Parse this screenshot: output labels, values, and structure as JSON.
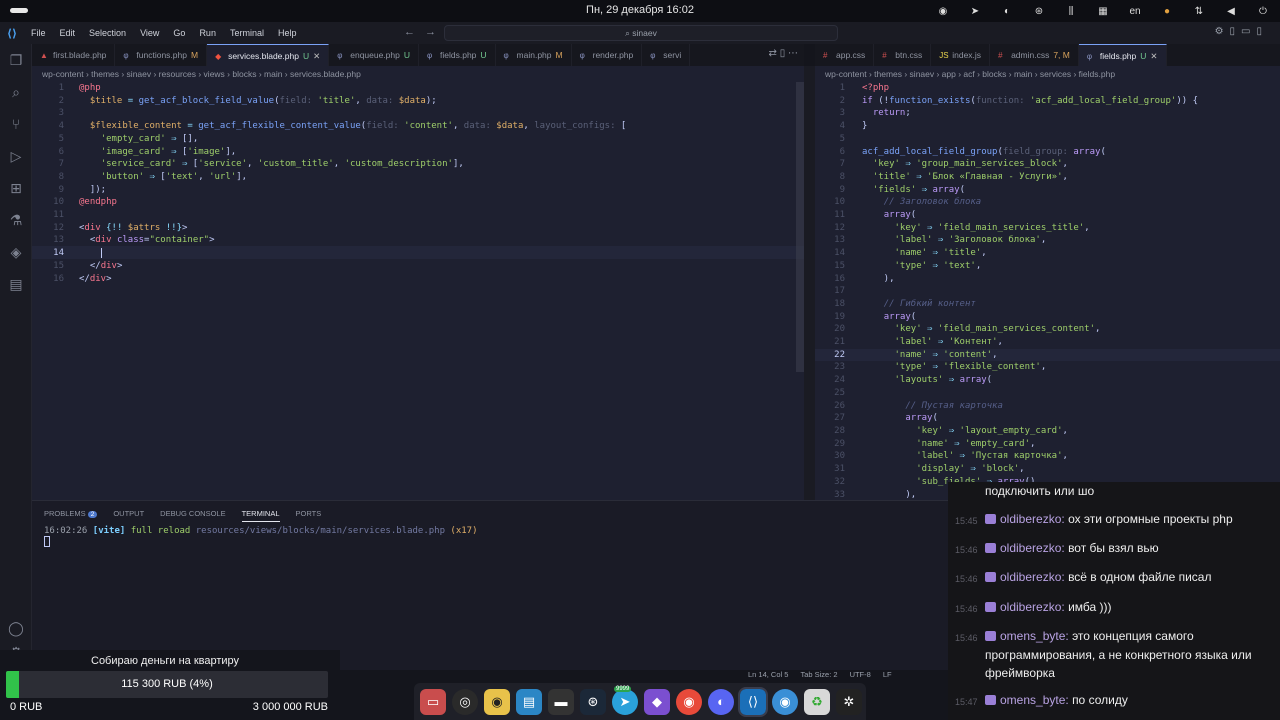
{
  "topbar": {
    "clock": "Пн, 29 декабря  16:02",
    "lang": "en"
  },
  "menubar": {
    "items": [
      "File",
      "Edit",
      "Selection",
      "View",
      "Go",
      "Run",
      "Terminal",
      "Help"
    ],
    "search": "sinaev"
  },
  "left_tabs": [
    {
      "label": "first.blade.php",
      "status": "",
      "icon": "php-icon",
      "active": false
    },
    {
      "label": "functions.php",
      "status": "M",
      "icon": "php-icon",
      "active": false
    },
    {
      "label": "services.blade.php",
      "status": "U",
      "icon": "laravel-icon",
      "active": true
    },
    {
      "label": "enqueue.php",
      "status": "U",
      "icon": "php-icon",
      "active": false
    },
    {
      "label": "fields.php",
      "status": "U",
      "icon": "php-icon",
      "active": false
    },
    {
      "label": "main.php",
      "status": "M",
      "icon": "php-icon",
      "active": false
    },
    {
      "label": "render.php",
      "status": "",
      "icon": "php-icon",
      "active": false
    },
    {
      "label": "servi",
      "status": "",
      "icon": "php-icon",
      "active": false
    }
  ],
  "right_tabs": [
    {
      "label": "app.css",
      "status": "",
      "active": false
    },
    {
      "label": "btn.css",
      "status": "",
      "active": false
    },
    {
      "label": "index.js",
      "status": "",
      "active": false
    },
    {
      "label": "admin.css",
      "status": "7, M",
      "active": false
    },
    {
      "label": "fields.php",
      "status": "U",
      "active": true
    }
  ],
  "left_breadcrumb": "wp-content › themes › sinaev › resources › views › blocks › main › services.blade.php",
  "right_breadcrumb": "wp-content › themes › sinaev › app › acf › blocks › main › services › fields.php",
  "left_line_numbers": [
    "1",
    "2",
    "3",
    "4",
    "5",
    "6",
    "7",
    "8",
    "9",
    "10",
    "11",
    "12",
    "13",
    "14",
    "15",
    "16"
  ],
  "right_line_numbers": [
    "1",
    "2",
    "3",
    "4",
    "5",
    "6",
    "7",
    "8",
    "9",
    "10",
    "11",
    "12",
    "13",
    "14",
    "15",
    "16",
    "17",
    "18",
    "19",
    "20",
    "21",
    "22",
    "23",
    "24",
    "25",
    "26",
    "27",
    "28",
    "29",
    "30",
    "31",
    "32",
    "33"
  ],
  "panel": {
    "tabs": [
      "PROBLEMS",
      "OUTPUT",
      "DEBUG CONSOLE",
      "TERMINAL",
      "PORTS"
    ],
    "problems_count": "2",
    "active_tab": "TERMINAL",
    "term_time": "16:02:26",
    "term_tag": "[vite]",
    "term_msg": "full reload",
    "term_path": "resources/views/blocks/main/services.blade.php",
    "term_count": "(x17)"
  },
  "statusbar": {
    "position": "Ln 14, Col 5",
    "tab_size": "Tab Size: 2",
    "encoding": "UTF-8",
    "eol": "LF"
  },
  "donate": {
    "title": "Собираю деньги на квартиру",
    "amount": "115 300 RUB (4%)",
    "progress_fraction": 0.04,
    "min": "0 RUB",
    "max": "3 000 000 RUB"
  },
  "chat": [
    {
      "time": "",
      "user": "",
      "text": "подключить или шо"
    },
    {
      "time": "15:45",
      "user": "oldiberezko:",
      "text": "ох эти огромные проекты php"
    },
    {
      "time": "15:46",
      "user": "oldiberezko:",
      "text": "вот бы взял вью"
    },
    {
      "time": "15:46",
      "user": "oldiberezko:",
      "text": "всё в одном файле писал"
    },
    {
      "time": "15:46",
      "user": "oldiberezko:",
      "text": "имба )))"
    },
    {
      "time": "15:46",
      "user": "omens_byte:",
      "text": "это концепция самого программирования, а не конкретного языка или фреймворка"
    },
    {
      "time": "15:47",
      "user": "omens_byte:",
      "text": "по солиду"
    }
  ],
  "dock_badge": "9999",
  "colors": {
    "accent": "#7aa2f7",
    "progress": "#31c24a",
    "editor_bg": "#1e2030"
  }
}
